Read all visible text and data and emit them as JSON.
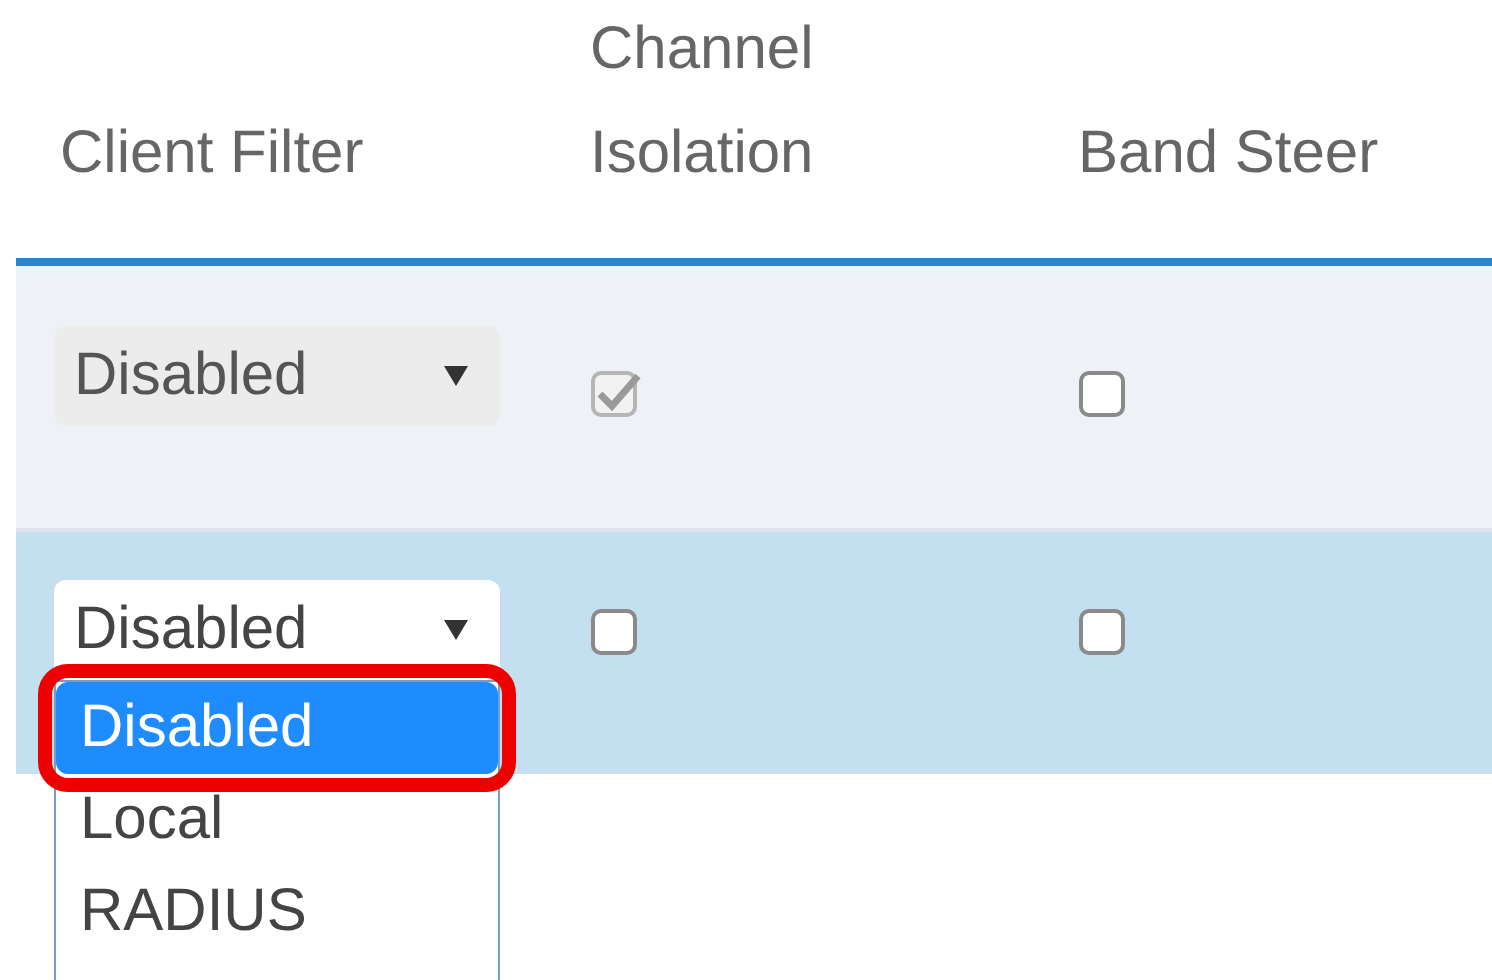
{
  "table": {
    "columns": [
      "Client Filter",
      "Channel Isolation",
      "Band Steer"
    ],
    "rows": [
      {
        "client_filter": {
          "value": "Disabled",
          "disabled": true,
          "expanded": false
        },
        "channel_isolation": {
          "checked": true,
          "disabled": true
        },
        "band_steer": {
          "checked": false,
          "disabled": false
        },
        "selected": false
      },
      {
        "client_filter": {
          "value": "Disabled",
          "disabled": false,
          "expanded": true,
          "options": [
            {
              "label": "Disabled",
              "selected": true,
              "highlighted": true
            },
            {
              "label": "Local",
              "selected": false,
              "highlighted": false
            },
            {
              "label": "RADIUS",
              "selected": false,
              "highlighted": false
            }
          ]
        },
        "channel_isolation": {
          "checked": false,
          "disabled": false
        },
        "band_steer": {
          "checked": false,
          "disabled": false
        },
        "selected": true
      }
    ]
  }
}
